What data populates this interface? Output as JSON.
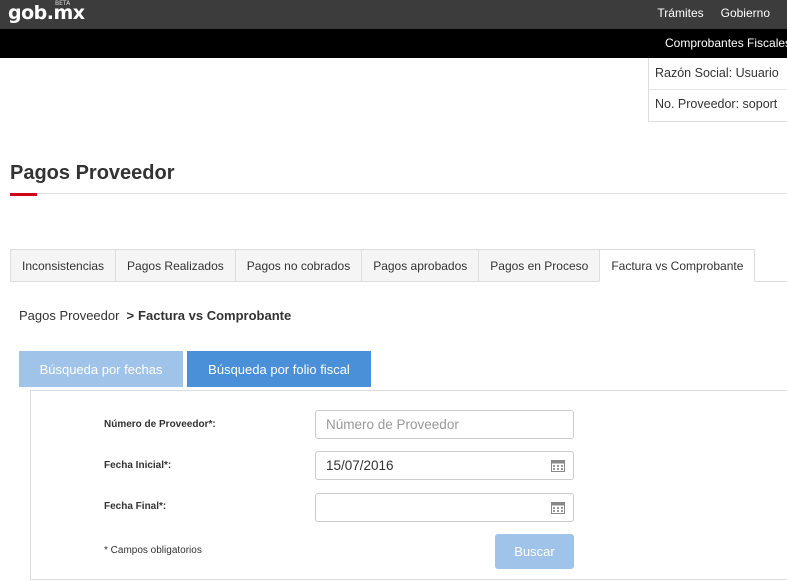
{
  "header": {
    "logo": "gob.mx",
    "logo_badge": "BETA",
    "nav": [
      "Trámites",
      "Gobierno"
    ]
  },
  "subnav": {
    "item": "Comprobantes Fiscales"
  },
  "user": {
    "razon_social": "Razón Social: Usuario",
    "no_proveedor": "No. Proveedor: soport"
  },
  "page": {
    "title": "Pagos Proveedor"
  },
  "tabs": [
    {
      "label": "Inconsistencias"
    },
    {
      "label": "Pagos Realizados"
    },
    {
      "label": "Pagos no cobrados"
    },
    {
      "label": "Pagos aprobados"
    },
    {
      "label": "Pagos en Proceso"
    },
    {
      "label": "Factura vs Comprobante"
    }
  ],
  "breadcrumb": {
    "root": "Pagos Proveedor",
    "separator": ">",
    "current": "Factura vs Comprobante"
  },
  "search_tabs": {
    "by_date": "Búsqueda por fechas",
    "by_folio": "Búsqueda por folio fiscal"
  },
  "form": {
    "proveedor_label": "Número de Proveedor*:",
    "proveedor_placeholder": "Número de Proveedor",
    "proveedor_value": "",
    "fecha_inicial_label": "Fecha Inicial*:",
    "fecha_inicial_value": "15/07/2016",
    "fecha_final_label": "Fecha Final*:",
    "fecha_final_value": "",
    "required_note": "* Campos obligatorios",
    "submit_label": "Buscar"
  },
  "colors": {
    "accent_red": "#d0021b",
    "primary_blue": "#4a90d9",
    "disabled_blue": "#a0c3e9",
    "topbar": "#3c3c3c",
    "subbar": "#000000"
  }
}
